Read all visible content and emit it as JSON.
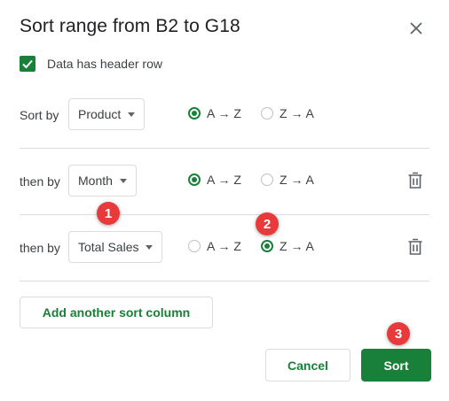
{
  "dialog": {
    "title": "Sort range from B2 to G18",
    "close_icon": "close-icon"
  },
  "header_row": {
    "label": "Data has header row",
    "checked": true
  },
  "sort_rows": [
    {
      "label": "Sort by",
      "column": "Product",
      "asc_label": "A → Z",
      "desc_label": "Z → A",
      "selected": "asc",
      "deletable": false
    },
    {
      "label": "then by",
      "column": "Month",
      "asc_label": "A → Z",
      "desc_label": "Z → A",
      "selected": "asc",
      "deletable": true
    },
    {
      "label": "then by",
      "column": "Total Sales",
      "asc_label": "A → Z",
      "desc_label": "Z → A",
      "selected": "desc",
      "deletable": true
    }
  ],
  "buttons": {
    "add_column": "Add another sort column",
    "cancel": "Cancel",
    "sort": "Sort"
  },
  "markers": [
    "1",
    "2",
    "3"
  ],
  "colors": {
    "accent": "#188038",
    "marker": "#e8393b",
    "border": "#dadce0"
  }
}
